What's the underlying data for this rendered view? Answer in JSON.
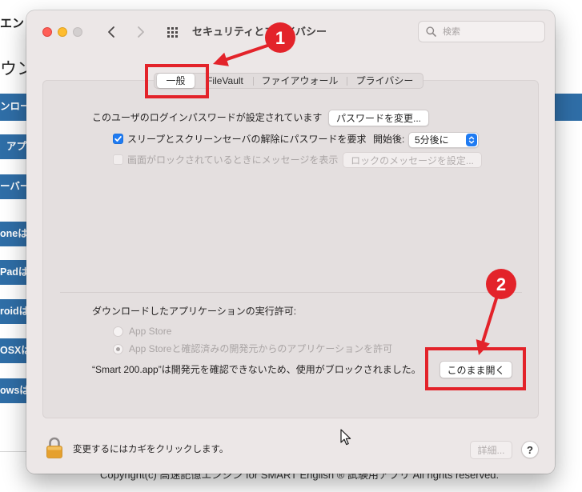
{
  "background_page": {
    "heading_fragment": "エン",
    "subheading_fragment": "ウン",
    "side_buttons": [
      "ンロー",
      "アプ",
      "ーバー",
      "oneは",
      "Padは",
      "roidは",
      "OSXは",
      "owsは"
    ],
    "footer_text": "Copyright(c) 高速記憶エンジン for SMART English ® 試験用アプリ All rights reserved."
  },
  "window": {
    "title": "セキュリティとプライバシー",
    "search": {
      "placeholder": "検索"
    },
    "tabs": [
      {
        "label": "一般",
        "selected": true
      },
      {
        "label": "FileVault",
        "selected": false
      },
      {
        "label": "ファイアウォール",
        "selected": false
      },
      {
        "label": "プライバシー",
        "selected": false
      }
    ],
    "general": {
      "login_password_text": "このユーザのログインパスワードが設定されています",
      "change_password_button": "パスワードを変更...",
      "require_password": {
        "label": "スリープとスクリーンセーバの解除にパスワードを要求",
        "checked": true,
        "delay_label": "開始後:",
        "delay_value": "5分後に"
      },
      "show_message": {
        "label": "画面がロックされているときにメッセージを表示",
        "checked": false,
        "enabled": false,
        "button": "ロックのメッセージを設定..."
      },
      "downloads": {
        "title": "ダウンロードしたアプリケーションの実行許可:",
        "options": [
          {
            "label": "App Store",
            "selected": false
          },
          {
            "label": "App Storeと確認済みの開発元からのアプリケーションを許可",
            "selected": true
          }
        ],
        "blocked_message": "“Smart 200.app”は開発元を確認できないため、使用がブロックされました。",
        "open_anyway_button": "このまま開く"
      }
    },
    "footer": {
      "lock_text": "変更するにはカギをクリックします。",
      "advanced_button": "詳細...",
      "help_button": "?"
    }
  },
  "annotations": {
    "markers": [
      {
        "label": "1"
      },
      {
        "label": "2"
      }
    ]
  },
  "icons": {
    "back": "chevron-left-icon",
    "forward": "chevron-right-icon",
    "show_all": "grid-icon",
    "search": "search-icon",
    "lock": "padlock-icon",
    "cursor": "mouse-pointer-icon"
  },
  "colors": {
    "accent": "#1f7bf2",
    "annotation": "#e3232a",
    "side_button": "#2f6ea7",
    "window_bg": "#ece7e7",
    "close": "#ff5f57",
    "minimize": "#febc2e"
  }
}
